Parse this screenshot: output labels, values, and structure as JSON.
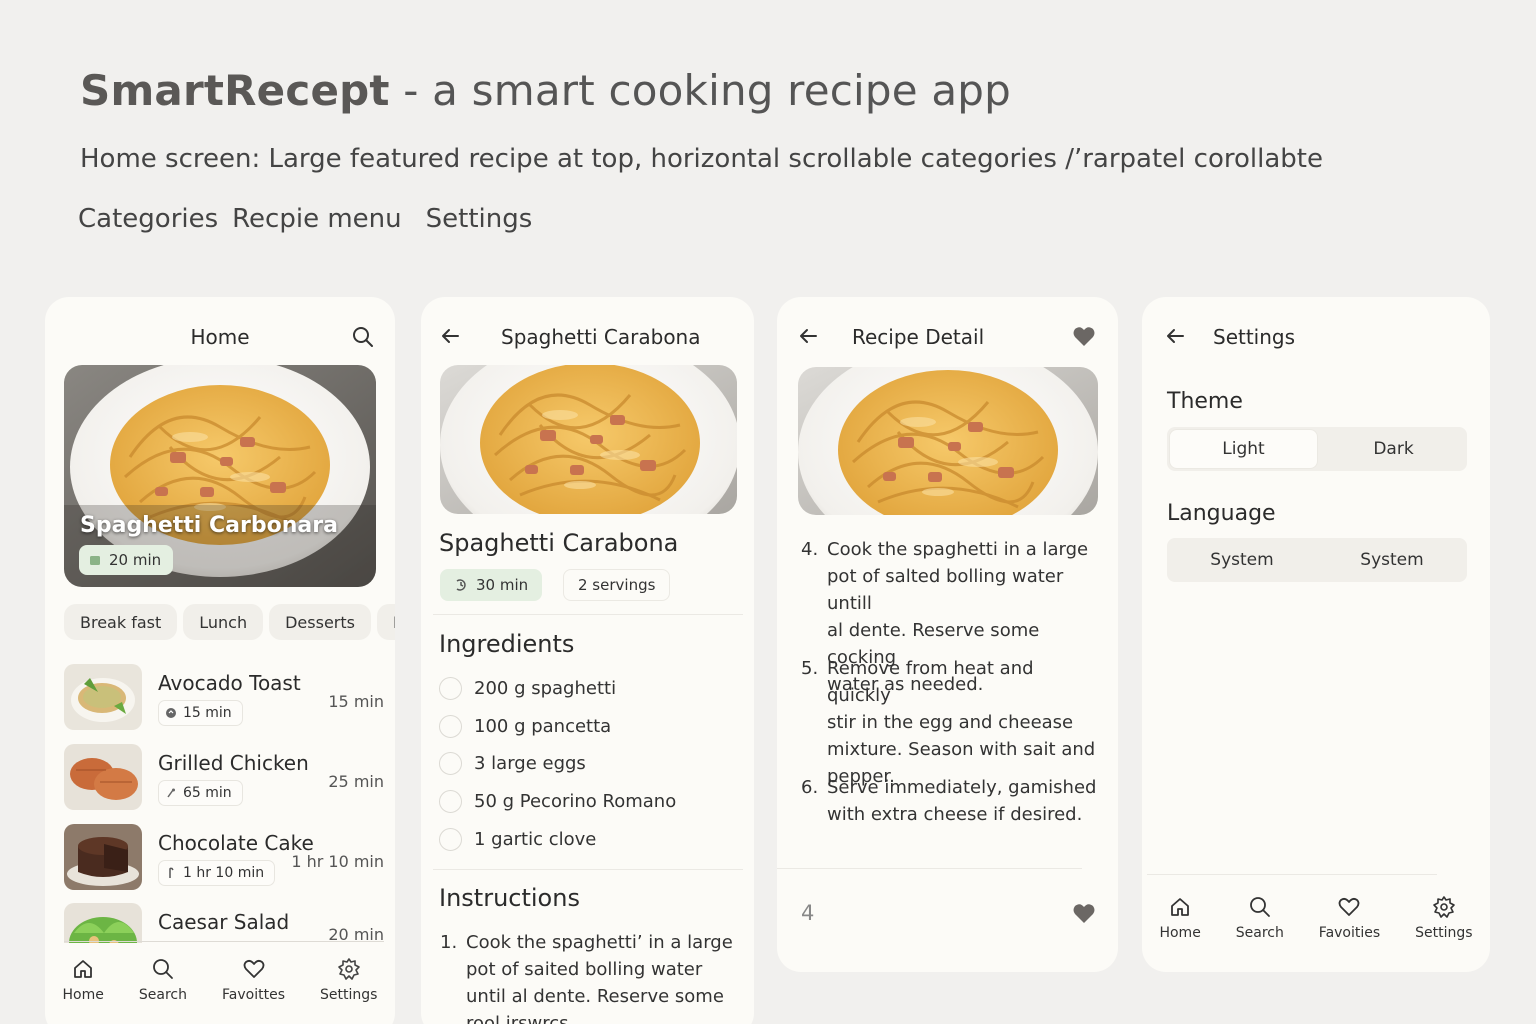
{
  "header": {
    "app_name": "SmartRecept",
    "tagline": " - a smart cooking recipe app",
    "subtitle": "Home screen: Large featured recipe at top, horizontal scrollable categories /’rarpatel corollabte",
    "nav": [
      "Categories",
      "Recpie menu",
      "Settings"
    ]
  },
  "home": {
    "title": "Home",
    "featured": {
      "name": "Spaghetti Carbonara",
      "time": "20 min"
    },
    "categories": [
      "Break fast",
      "Lunch",
      "Desserts",
      "Din"
    ],
    "recipes": [
      {
        "name": "Avocado Toast",
        "badge": "15 min",
        "time": "15 min"
      },
      {
        "name": "Grilled Chicken",
        "badge": "65 min",
        "time": "25 min"
      },
      {
        "name": "Chocolate Cake",
        "badge": "1 hr 10 min",
        "time": "1 hr 10 min"
      },
      {
        "name": "Caesar Salad",
        "time": "20 min"
      }
    ],
    "nav": {
      "home": "Home",
      "search": "Search",
      "favorites": "Favoittes",
      "settings": "Settings"
    }
  },
  "recipe": {
    "title": "Spaghetti Carabona",
    "name": "Spaghetti Carabona",
    "time": "30 min",
    "servings": "2 servings",
    "ingredients_heading": "Ingredients",
    "ingredients": [
      "200 g spaghetti",
      "100 g pancetta",
      "3 large eggs",
      "50 g Pecorino Romano",
      "1 gartic clove"
    ],
    "instructions_heading": "Instructions",
    "instructions": [
      {
        "num": "1.",
        "lines": [
          "Cook the spaghetti’ in a large",
          "pot of saited bolling water",
          "until al dente. Reserve some",
          "rool irswrcs"
        ]
      }
    ]
  },
  "detail": {
    "title": "Recipe Detail",
    "steps": [
      {
        "num": "4.",
        "lines": [
          "Cook the spaghetti in a large",
          "pot of salted bolling water untill",
          "al dente. Reserve some cocking",
          "water as needed."
        ]
      },
      {
        "num": "5.",
        "lines": [
          "Remove from heat and quickly",
          "stir in the egg and cheease",
          "mixture. Season with sait and",
          "pepper."
        ]
      },
      {
        "num": "6.",
        "lines": [
          "Serve immediately, gamished",
          "with extra cheese if desired."
        ]
      }
    ],
    "page_indicator": "4"
  },
  "settings": {
    "title": "Settings",
    "theme_label": "Theme",
    "theme_options": [
      "Light",
      "Dark"
    ],
    "language_label": "Language",
    "language_options": [
      "System",
      "System"
    ],
    "nav": {
      "home": "Home",
      "search": "Search",
      "favorites": "Favoities",
      "settings": "Settings"
    }
  },
  "colors": {
    "background": "#f1f0ee",
    "card": "#fcfbf7",
    "badge_green": "#e4efe1",
    "chip": "#f1efea"
  }
}
